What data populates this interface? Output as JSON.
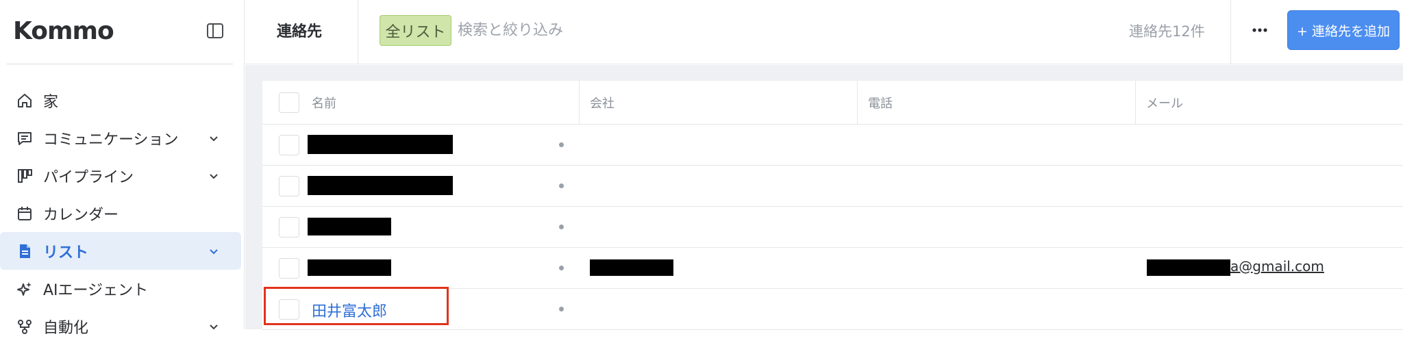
{
  "brand": {
    "logo_text": "Kommo"
  },
  "sidebar": {
    "items": [
      {
        "label": "家",
        "icon": "home-icon",
        "expandable": false,
        "active": false
      },
      {
        "label": "コミュニケーション",
        "icon": "chat-icon",
        "expandable": true,
        "active": false
      },
      {
        "label": "パイプライン",
        "icon": "pipeline-icon",
        "expandable": true,
        "active": false
      },
      {
        "label": "カレンダー",
        "icon": "calendar-icon",
        "expandable": false,
        "active": false
      },
      {
        "label": "リスト",
        "icon": "document-icon",
        "expandable": true,
        "active": true
      },
      {
        "label": "AIエージェント",
        "icon": "sparkle-icon",
        "expandable": false,
        "active": false
      },
      {
        "label": "自動化",
        "icon": "flow-icon",
        "expandable": true,
        "active": false
      }
    ]
  },
  "header": {
    "title": "連絡先",
    "filter_chip": "全リスト",
    "search_placeholder": "検索と絞り込み",
    "count_text": "連絡先12件",
    "more_icon": "more-horizontal-icon",
    "add_button": "+ 連絡先を追加"
  },
  "table": {
    "columns": [
      "名前",
      "会社",
      "電話",
      "メール"
    ],
    "rows": [
      {
        "name": "",
        "name_redacted": true,
        "company": "",
        "phone": "",
        "email": ""
      },
      {
        "name": "",
        "name_redacted": true,
        "company": "",
        "phone": "",
        "email": ""
      },
      {
        "name": "",
        "name_redacted": true,
        "company": "",
        "phone": "",
        "email": ""
      },
      {
        "name": "",
        "name_redacted": true,
        "company_redacted": true,
        "phone": "",
        "email_visible_suffix": "a@gmail.com"
      },
      {
        "name": "田井富太郎",
        "name_redacted": false,
        "highlighted": true,
        "company": "",
        "phone": "",
        "email": ""
      }
    ]
  },
  "colors": {
    "accent": "#4c8ef0",
    "active_nav_bg": "#e6eefa",
    "active_nav_text": "#2f6fd6",
    "chip_bg": "#cfe5a9",
    "highlight_border": "#e2321c"
  }
}
